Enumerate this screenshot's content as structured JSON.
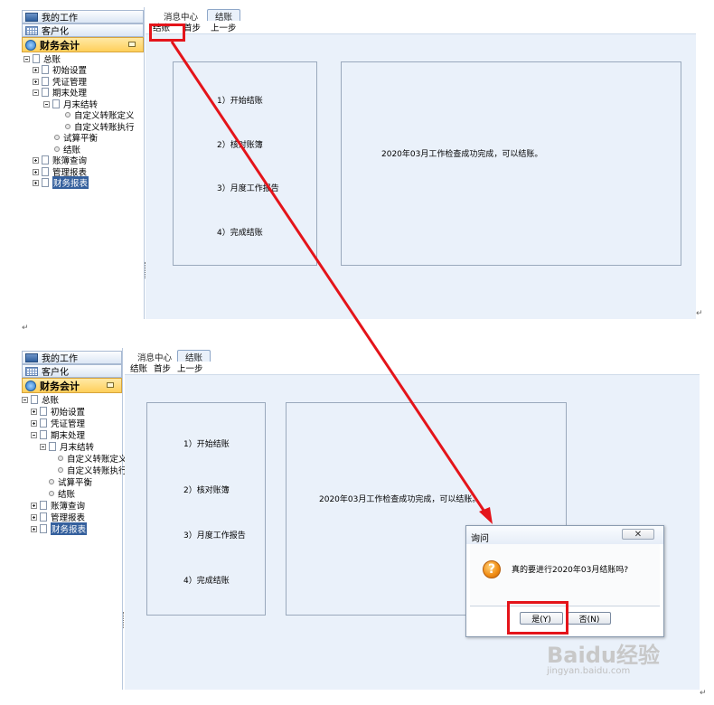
{
  "colors": {
    "highlight": "#e4141a",
    "arrow": "#e4141a",
    "selected_bg": "#35609d",
    "panel_bg": "#eaf1fa"
  },
  "sidebar": {
    "my_work": "我的工作",
    "customize": "客户化",
    "finance": "财务会计",
    "tree": {
      "root": "总账",
      "init": "初始设置",
      "voucher": "凭证管理",
      "period_end": "期末处理",
      "monthly_transfer": "月末结转",
      "custom_def": "自定义转账定义",
      "custom_exec": "自定义转账执行",
      "trial_balance": "试算平衡",
      "closing": "结账",
      "ledger_query": "账簿查询",
      "mgmt_report": "管理报表",
      "fin_report": "财务报表"
    }
  },
  "tabs": {
    "message_center": "消息中心",
    "closing": "结账"
  },
  "toolbar": {
    "close": "结账",
    "first": "首步",
    "prev": "上一步"
  },
  "steps": {
    "s1": "1）开始结账",
    "s2": "2）核对账簿",
    "s3": "3）月度工作报告",
    "s4": "4）完成结账"
  },
  "message": "2020年03月工作检查成功完成，可以结账。",
  "dialog": {
    "title": "询问",
    "question": "真的要进行2020年03月结账吗?",
    "yes": "是(Y)",
    "no": "否(N)",
    "icon": "question-icon"
  },
  "watermark": {
    "brand": "Baidu经验",
    "url": "jingyan.baidu.com"
  },
  "return_mark": "↵"
}
